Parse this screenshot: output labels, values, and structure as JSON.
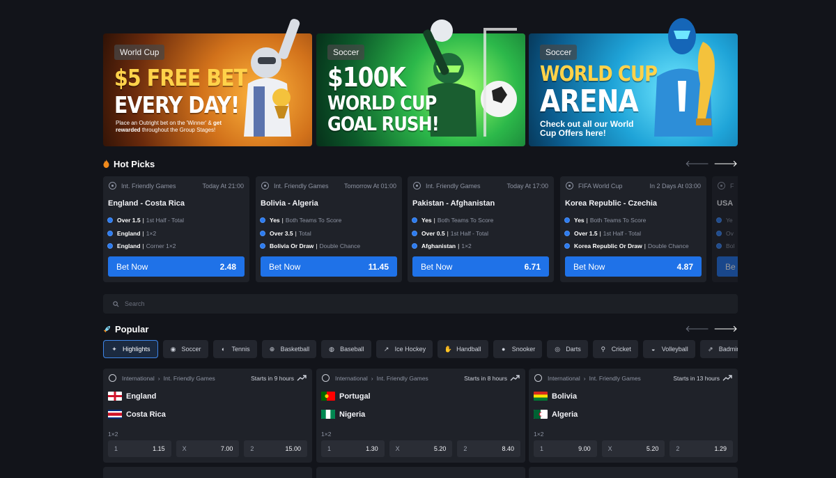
{
  "banners": [
    {
      "chip": "World Cup",
      "line1": "$5 FREE BET",
      "line2": "EVERY DAY!",
      "small_pre": "Place an Outright bet on the 'Winner' &",
      "small_bold": "get rewarded",
      "small_post": "throughout the Group Stages!"
    },
    {
      "chip": "Soccer",
      "line1": "$100K",
      "line2": "WORLD CUP",
      "line3": "GOAL RUSH!"
    },
    {
      "chip": "Soccer",
      "line1": "WORLD CUP",
      "line2": "ARENA",
      "cta_pre": "Check out all our",
      "cta_bold": "World Cup Offers",
      "cta_post": "here!"
    }
  ],
  "hot_picks": {
    "title": "Hot Picks",
    "cards": [
      {
        "league": "Int. Friendly Games",
        "time": "Today At 21:00",
        "match": "England - Costa Rica",
        "legs": [
          {
            "sel": "Over 1.5",
            "mkt": "1st Half - Total"
          },
          {
            "sel": "England",
            "mkt": "1×2"
          },
          {
            "sel": "England",
            "mkt": "Corner 1×2"
          }
        ],
        "bet_label": "Bet Now",
        "odds": "2.48"
      },
      {
        "league": "Int. Friendly Games",
        "time": "Tomorrow At 01:00",
        "match": "Bolivia - Algeria",
        "legs": [
          {
            "sel": "Yes",
            "mkt": "Both Teams To Score"
          },
          {
            "sel": "Over 3.5",
            "mkt": "Total"
          },
          {
            "sel": "Bolivia Or Draw",
            "mkt": "Double Chance"
          }
        ],
        "bet_label": "Bet Now",
        "odds": "11.45"
      },
      {
        "league": "Int. Friendly Games",
        "time": "Today At 17:00",
        "match": "Pakistan - Afghanistan",
        "legs": [
          {
            "sel": "Yes",
            "mkt": "Both Teams To Score"
          },
          {
            "sel": "Over 0.5",
            "mkt": "1st Half - Total"
          },
          {
            "sel": "Afghanistan",
            "mkt": "1×2"
          }
        ],
        "bet_label": "Bet Now",
        "odds": "6.71"
      },
      {
        "league": "FIFA World Cup",
        "time": "In 2 Days At 03:00",
        "match": "Korea Republic - Czechia",
        "legs": [
          {
            "sel": "Yes",
            "mkt": "Both Teams To Score"
          },
          {
            "sel": "Over 1.5",
            "mkt": "1st Half - Total"
          },
          {
            "sel": "Korea Republic Or Draw",
            "mkt": "Double Chance"
          }
        ],
        "bet_label": "Bet Now",
        "odds": "4.87"
      }
    ],
    "peek_card": {
      "league": "F",
      "match": "USA",
      "legs": [
        "Ye",
        "Ov",
        "Bol"
      ],
      "bet_label": "Be"
    }
  },
  "search": {
    "placeholder": "Search"
  },
  "popular": {
    "title": "Popular",
    "sports": [
      {
        "label": "Highlights",
        "icon": "sparkle-icon",
        "active": true
      },
      {
        "label": "Soccer",
        "icon": "soccer-ball-icon"
      },
      {
        "label": "Tennis",
        "icon": "tennis-ball-icon"
      },
      {
        "label": "Basketball",
        "icon": "basketball-icon"
      },
      {
        "label": "Baseball",
        "icon": "baseball-icon"
      },
      {
        "label": "Ice Hockey",
        "icon": "hockey-stick-icon"
      },
      {
        "label": "Handball",
        "icon": "handball-icon"
      },
      {
        "label": "Snooker",
        "icon": "snooker-icon"
      },
      {
        "label": "Darts",
        "icon": "darts-icon"
      },
      {
        "label": "Cricket",
        "icon": "cricket-icon"
      },
      {
        "label": "Volleyball",
        "icon": "volleyball-icon"
      },
      {
        "label": "Badminton",
        "icon": "badminton-icon"
      }
    ],
    "matches": [
      {
        "region": "International",
        "league": "Int. Friendly Games",
        "starts": "Starts in 9 hours",
        "home": "England",
        "away": "Costa Rica",
        "market": "1×2",
        "odds": [
          {
            "k": "1",
            "v": "1.15"
          },
          {
            "k": "X",
            "v": "7.00"
          },
          {
            "k": "2",
            "v": "15.00"
          }
        ]
      },
      {
        "region": "International",
        "league": "Int. Friendly Games",
        "starts": "Starts in 8 hours",
        "home": "Portugal",
        "away": "Nigeria",
        "market": "1×2",
        "odds": [
          {
            "k": "1",
            "v": "1.30"
          },
          {
            "k": "X",
            "v": "5.20"
          },
          {
            "k": "2",
            "v": "8.40"
          }
        ]
      },
      {
        "region": "International",
        "league": "Int. Friendly Games",
        "starts": "Starts in 13 hours",
        "home": "Bolivia",
        "away": "Algeria",
        "market": "1×2",
        "odds": [
          {
            "k": "1",
            "v": "9.00"
          },
          {
            "k": "X",
            "v": "5.20"
          },
          {
            "k": "2",
            "v": "1.29"
          }
        ]
      }
    ]
  },
  "colors": {
    "accent": "#1f72e8",
    "card": "#1f2229",
    "bg": "#12141a"
  }
}
